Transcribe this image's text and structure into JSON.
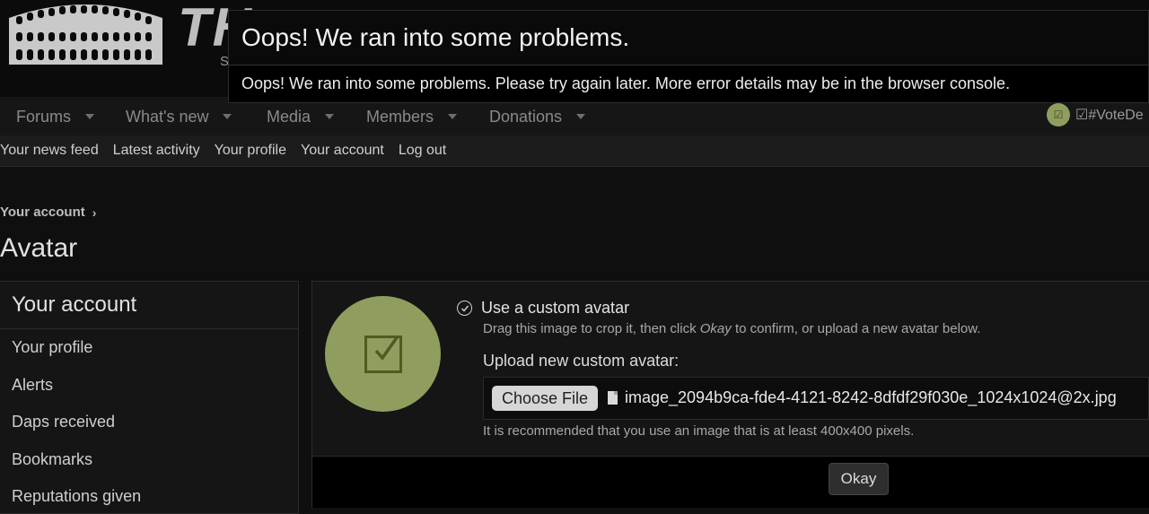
{
  "header": {
    "logo_text": "TH",
    "logo_sub": "S"
  },
  "nav": {
    "items": [
      {
        "label": "Forums"
      },
      {
        "label": "What's new"
      },
      {
        "label": "Media"
      },
      {
        "label": "Members"
      },
      {
        "label": "Donations"
      }
    ],
    "user_badge": "☑",
    "user_label": "☑#VoteDe"
  },
  "subnav": {
    "links": [
      "Your news feed",
      "Latest activity",
      "Your profile",
      "Your account",
      "Log out"
    ]
  },
  "breadcrumb": {
    "item": "Your account"
  },
  "page": {
    "title": "Avatar"
  },
  "sidebar": {
    "title": "Your account",
    "items": [
      "Your profile",
      "Alerts",
      "Daps received",
      "Bookmarks",
      "Reputations given"
    ]
  },
  "avatar_panel": {
    "option_label": "Use a custom avatar",
    "hint_pre": "Drag this image to crop it, then click ",
    "hint_em": "Okay",
    "hint_post": " to confirm, or upload a new avatar below.",
    "upload_label": "Upload new custom avatar:",
    "choose_file_label": "Choose File",
    "file_name": "image_2094b9ca-fde4-4121-8242-8dfdf29f030e_1024x1024@2x.jpg",
    "recommendation": "It is recommended that you use an image that is at least 400x400 pixels.",
    "okay_label": "Okay",
    "avatar_color": "#8f9e5e"
  },
  "error_overlay": {
    "title": "Oops! We ran into some problems.",
    "message": "Oops! We ran into some problems. Please try again later. More error details may be in the browser console."
  }
}
